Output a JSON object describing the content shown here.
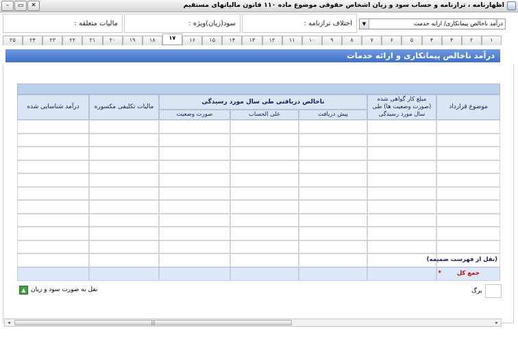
{
  "window": {
    "title": "اظهارنامه ، ترازنامه و حساب سود و زیان اشخاص حقوقی موضوع ماده ۱۱۰ قانون مالیاتهای مستقیم",
    "minimize": "–",
    "restore": "▭",
    "close": "✕"
  },
  "header": {
    "maliat_label": "مالیات متعلقه :",
    "profit_label": "سود(زیان)ویژه :",
    "diff_label": "اختلاف ترازنامه :",
    "combo_value": "درآمد ناخالص پیمانکاری/ ارایه خدمت"
  },
  "tabs": [
    "۱",
    "۲",
    "۳",
    "۴",
    "۵",
    "۶",
    "۷",
    "۸",
    "۹",
    "۱۰",
    "۱۱",
    "۱۲",
    "۱۳",
    "۱۴",
    "۱۵",
    "۱۶",
    "۱۷",
    "۱۸",
    "۱۹",
    "۲۰",
    "۲۱",
    "۲۲",
    "۲۳",
    "۲۴",
    "۲۵"
  ],
  "active_tab": "۱۷",
  "section_title": "درآمد ناخالص پیمانکاری و ارائه خدمات",
  "grid": {
    "col_contract": "موضوع قرارداد",
    "col_certified": "مبلغ کار گواهی شده (صورت وضعیت ها) طی سال مورد رسیدگی",
    "group_gross": "ناخالص دریافتی طی سال مورد رسیدگی",
    "col_advance": "پیش دریافت",
    "col_onaccount": "علی الحساب",
    "col_statement": "صورت وضعیت",
    "col_tax": "مالیات تکلیفی مکسوره",
    "col_income": "درآمد شناسایی شده",
    "row_transfer": "(نقل از فهرست ضمیمه)",
    "row_total": "جمع کل",
    "required_mark": "*"
  },
  "bottom": {
    "nav_label": "نقل به صورت سود و زیان",
    "nav_icon": "up-arrow-icon",
    "page_label": "برگ"
  },
  "colors": {
    "section_bar": "#4a7bd0",
    "header_cell": "#dbe6f4",
    "total_label": "#c00000"
  }
}
